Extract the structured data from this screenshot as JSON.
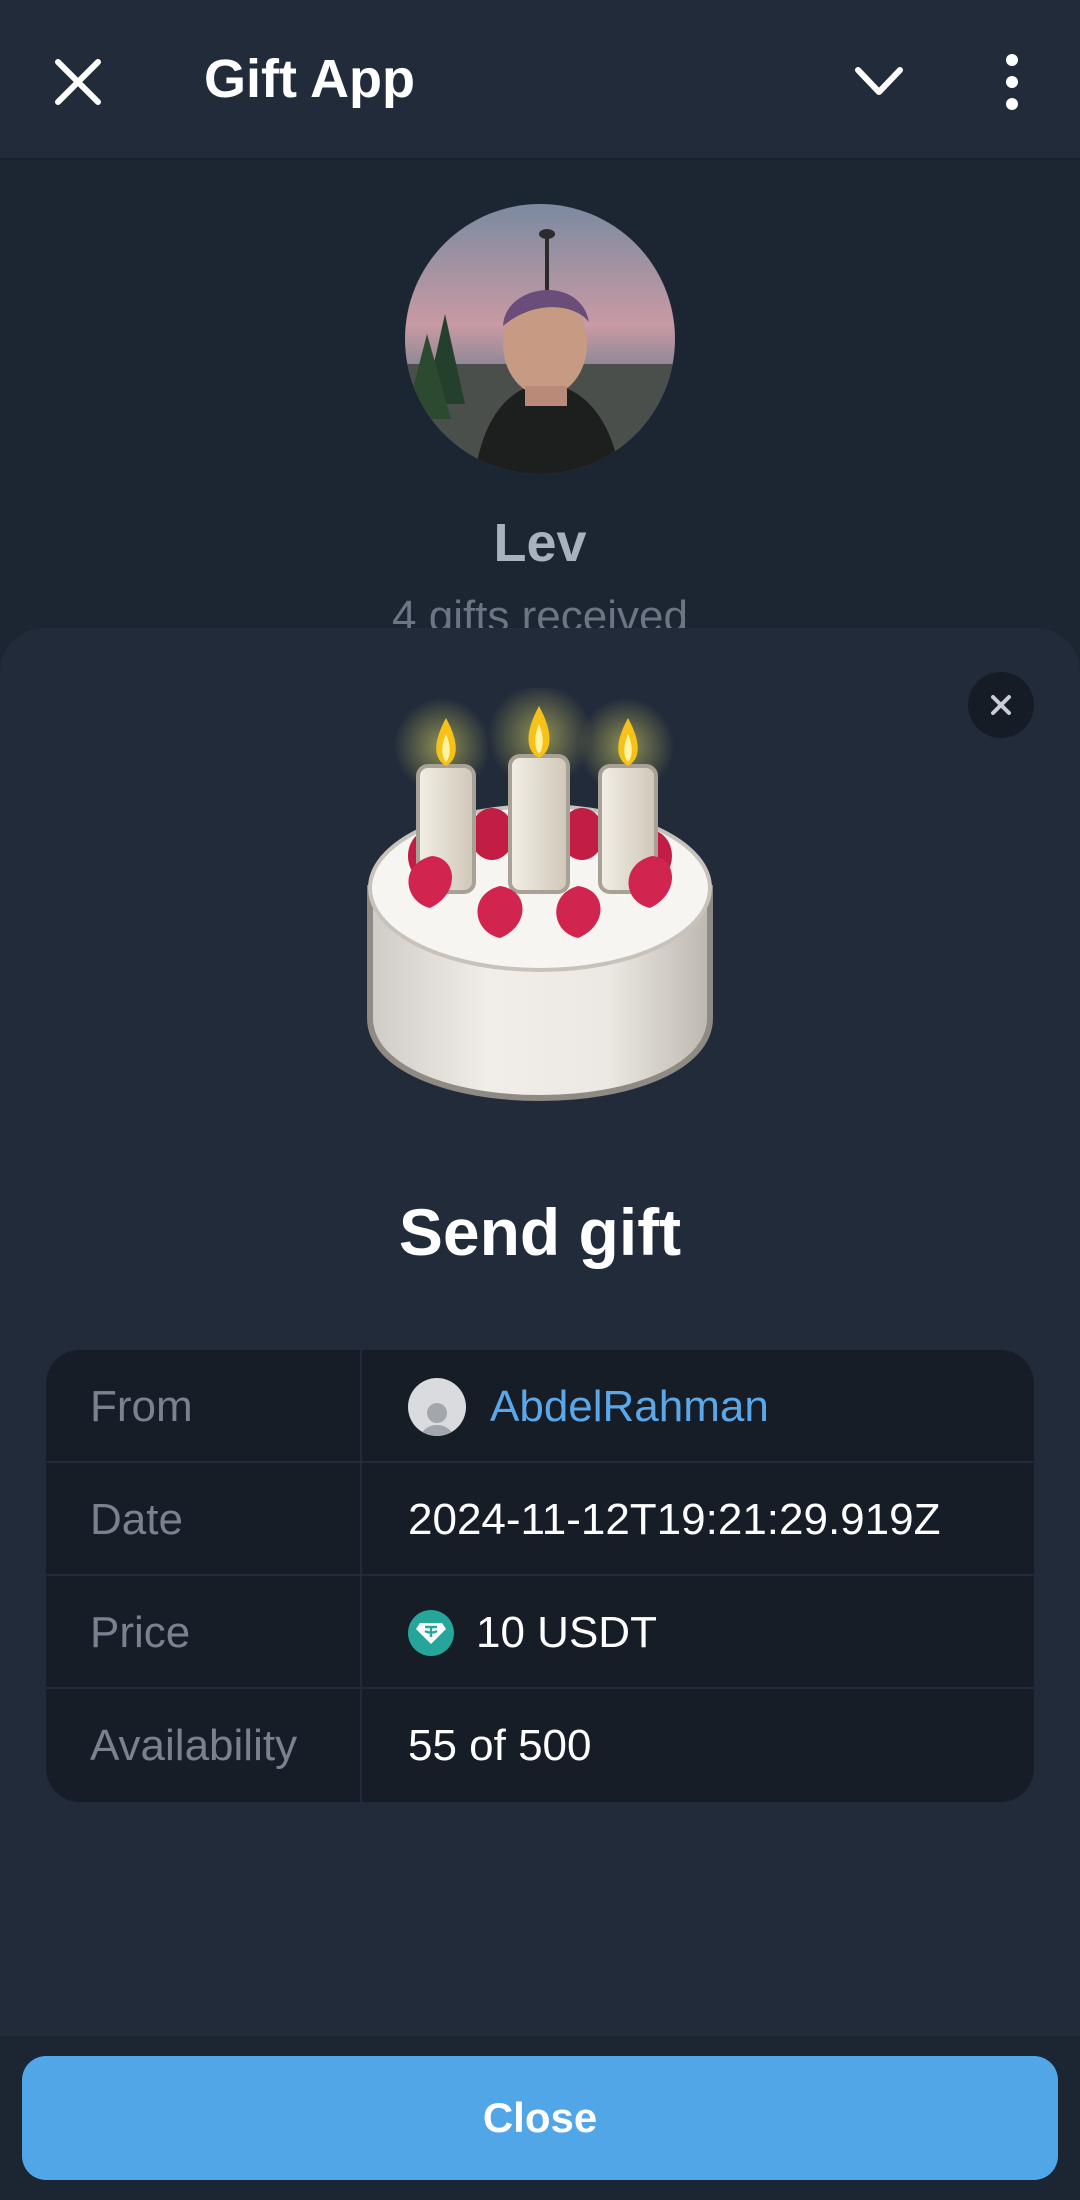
{
  "app_bar": {
    "title": "Gift App",
    "close_icon": "close-icon",
    "chevron_icon": "chevron-down-icon",
    "menu_icon": "more-vertical-icon"
  },
  "profile": {
    "name": "Lev",
    "subtitle": "4 gifts received"
  },
  "sheet": {
    "title": "Send gift",
    "gift_icon": "birthday-cake",
    "rows": [
      {
        "label": "From",
        "value": "AbdelRahman",
        "icon": "user-avatar-icon"
      },
      {
        "label": "Date",
        "value": "2024-11-12T19:21:29.919Z"
      },
      {
        "label": "Price",
        "value": "10 USDT",
        "icon": "usdt-icon"
      },
      {
        "label": "Availability",
        "value": "55 of 500"
      }
    ]
  },
  "footer": {
    "close_label": "Close"
  },
  "colors": {
    "accent": "#51a6e8",
    "link": "#5aa8ea",
    "background": "#1c2532",
    "sheet": "#222b3a",
    "usdt": "#26a69a"
  }
}
